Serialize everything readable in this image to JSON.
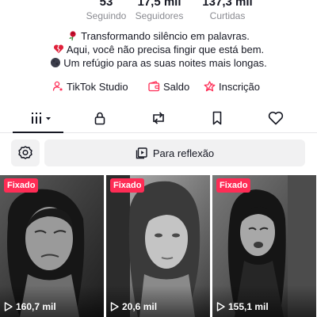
{
  "profile": {
    "stats": {
      "following": {
        "value": "53",
        "label": "Seguindo"
      },
      "followers": {
        "value": "17,5 mil",
        "label": "Seguidores"
      },
      "likes": {
        "value": "137,3 mil",
        "label": "Curtidas"
      }
    },
    "bio": [
      {
        "icon": "rose-emoji",
        "text": "Transformando silêncio em palavras."
      },
      {
        "icon": "broken-heart-emoji",
        "text": "Aqui, você não precisa fingir que está bem."
      },
      {
        "icon": "new-moon-emoji",
        "text": "Um refúgio para as suas noites mais longas."
      }
    ],
    "links": {
      "studio": "TikTok Studio",
      "saldo": "Saldo",
      "inscricao": "Inscrição"
    }
  },
  "tabs": [
    {
      "icon": "grid-videos-icon",
      "active": true
    },
    {
      "icon": "lock-icon",
      "active": false
    },
    {
      "icon": "repost-icon",
      "active": false
    },
    {
      "icon": "bookmark-icon",
      "active": false
    },
    {
      "icon": "heart-icon",
      "active": false
    }
  ],
  "playlist": {
    "label": "Para reflexão"
  },
  "videos": [
    {
      "badge": "Fixado",
      "views": "160,7 mil"
    },
    {
      "badge": "Fixado",
      "views": "20,6 mil"
    },
    {
      "badge": "Fixado",
      "views": "155,1 mil"
    }
  ],
  "colors": {
    "accent": "#fe2c55",
    "text": "#161823",
    "muted": "#8a8b91",
    "button_bg": "#f1f1f2"
  }
}
